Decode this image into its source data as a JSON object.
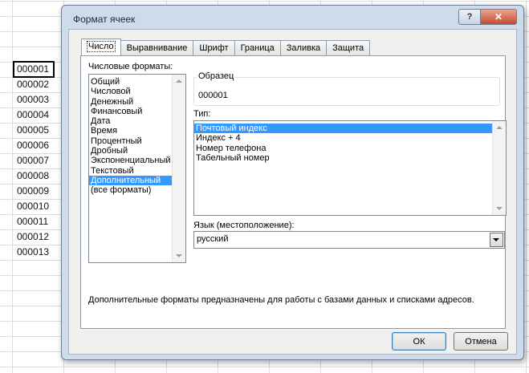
{
  "sheet": {
    "cells": [
      "000001",
      "000002",
      "000003",
      "000004",
      "000005",
      "000006",
      "000007",
      "000008",
      "000009",
      "000010",
      "000011",
      "000012",
      "000013"
    ],
    "active_index": 0
  },
  "dialog": {
    "title": "Формат ячеек",
    "help_glyph": "?",
    "close_glyph": "✕",
    "tabs": [
      "Число",
      "Выравнивание",
      "Шрифт",
      "Граница",
      "Заливка",
      "Защита"
    ],
    "active_tab": 0,
    "numeric_formats_label": "Числовые форматы:",
    "categories": [
      "Общий",
      "Числовой",
      "Денежный",
      "Финансовый",
      "Дата",
      "Время",
      "Процентный",
      "Дробный",
      "Экспоненциальный",
      "Текстовый",
      "Дополнительный",
      "(все форматы)"
    ],
    "selected_category": 10,
    "sample_label": "Образец",
    "sample_value": "000001",
    "type_label": "Тип:",
    "types": [
      "Почтовый индекс",
      "Индекс + 4",
      "Номер телефона",
      "Табельный номер"
    ],
    "selected_type": 0,
    "locale_label": "Язык (местоположение):",
    "locale_value": "русский",
    "description": "Дополнительные форматы предназначены для работы с базами данных и списками адресов.",
    "ok_label": "ОК",
    "cancel_label": "Отмена"
  }
}
